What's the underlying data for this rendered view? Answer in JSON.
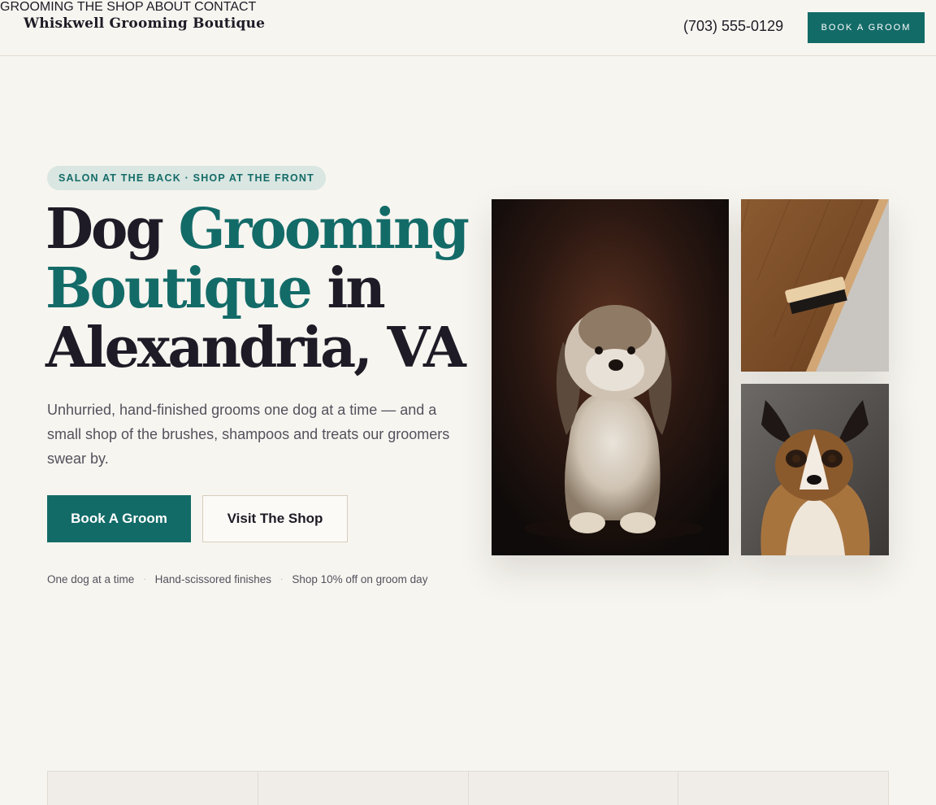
{
  "header": {
    "brand": "Whiskwell Grooming Boutique",
    "nav": [
      "GROOMING",
      "THE SHOP",
      "ABOUT",
      "CONTACT"
    ],
    "phone": "(703) 555-0129",
    "cta": "BOOK A GROOM"
  },
  "hero": {
    "eyebrow": "SALON AT THE BACK · SHOP AT THE FRONT",
    "headline": {
      "part1": "Dog ",
      "part2": "Grooming Boutique",
      "part3": " in Alexandria, VA"
    },
    "lede": "Unhurried, hand-finished grooms one dog at a time — and a small shop of the brushes, shampoos and treats our groomers swear by.",
    "primary_button": "Book A Groom",
    "secondary_button": "Visit The Shop",
    "perks": [
      "One dog at a time",
      "Hand-scissored finishes",
      "Shop 10% off on groom day"
    ],
    "perk_separator": "·"
  },
  "colors": {
    "accent": "#136b68",
    "background": "#f7f5f0",
    "text": "#1f1b26"
  }
}
